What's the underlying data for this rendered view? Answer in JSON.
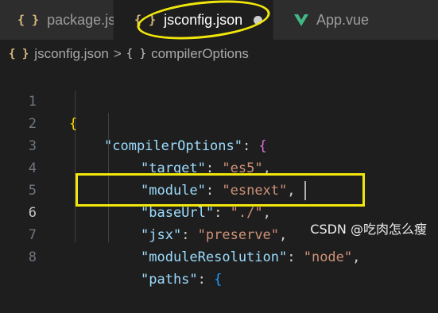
{
  "tabs": [
    {
      "label": "package.json",
      "icon": "json-braces-icon",
      "active": false
    },
    {
      "label": "jsconfig.json",
      "icon": "json-braces-icon",
      "active": true,
      "modified": true
    },
    {
      "label": "App.vue",
      "icon": "vue-icon",
      "active": false
    }
  ],
  "breadcrumb": {
    "file": "jsconfig.json",
    "symbol": "compilerOptions",
    "separator": ">"
  },
  "icons": {
    "json": "{ }",
    "object": "{ }"
  },
  "lines": [
    {
      "n": "1"
    },
    {
      "n": "2"
    },
    {
      "n": "3"
    },
    {
      "n": "4"
    },
    {
      "n": "5"
    },
    {
      "n": "6"
    },
    {
      "n": "7"
    },
    {
      "n": "8"
    }
  ],
  "code": {
    "open_brace": "{",
    "compilerOptions_key": "\"compilerOptions\"",
    "target_key": "\"target\"",
    "target_val": "\"es5\"",
    "module_key": "\"module\"",
    "module_val": "\"esnext\"",
    "baseUrl_key": "\"baseUrl\"",
    "baseUrl_val": "\"./\"",
    "jsx_key": "\"jsx\"",
    "jsx_val": "\"preserve\"",
    "moduleResolution_key": "\"moduleResolution\"",
    "moduleResolution_val": "\"node\"",
    "paths_key": "\"paths\"",
    "colon": ": ",
    "comma": ",",
    "brace": "{"
  },
  "watermark": "CSDN @吃肉怎么瘦",
  "colors": {
    "annotation": "#f2e70b",
    "key": "#9cdcfe",
    "string": "#ce9178"
  }
}
